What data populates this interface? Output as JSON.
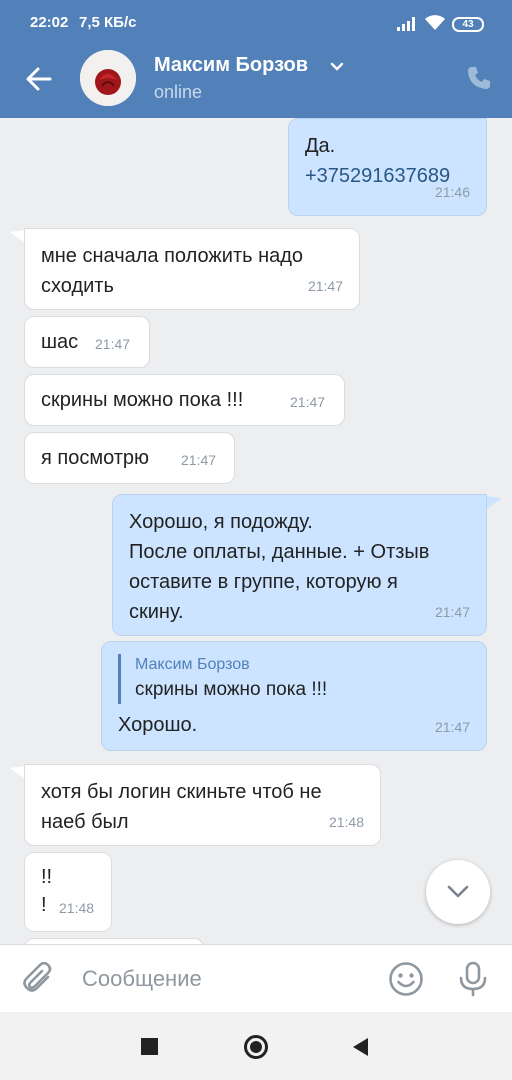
{
  "status": {
    "time": "22:02",
    "speed": "7,5 КБ/с",
    "battery": "43"
  },
  "header": {
    "contact_name": "Максим Борзов",
    "presence": "online"
  },
  "messages": [
    {
      "dir": "out",
      "lines": "Да.",
      "link": "+375291637689",
      "time": "21:46"
    },
    {
      "dir": "in",
      "lines": "мне сначала положить надо\nсходить",
      "time": "21:47"
    },
    {
      "dir": "in",
      "lines": "шас",
      "time": "21:47"
    },
    {
      "dir": "in",
      "lines": "скрины можно пока !!!",
      "time": "21:47"
    },
    {
      "dir": "in",
      "lines": "я посмотрю",
      "time": "21:47"
    },
    {
      "dir": "out",
      "lines": "Хорошо, я подожду.\nПосле оплаты, данные. + Отзыв\nоставите в группе, которую я\nскину.",
      "time": "21:47"
    },
    {
      "dir": "out",
      "reply_name": "Максим Борзов",
      "reply_text": "скрины можно пока !!!",
      "lines": "Хорошо.",
      "time": "21:47"
    },
    {
      "dir": "in",
      "lines": "хотя бы логин скиньте чтоб не\nнаеб был",
      "time": "21:48"
    },
    {
      "dir": "in",
      "lines": "!!\n!",
      "time": "21:48"
    }
  ],
  "composer": {
    "placeholder": "Сообщение"
  },
  "colors": {
    "header": "#5181b8",
    "incoming": "#ffffff",
    "outgoing": "#cce4ff",
    "link": "#2a5885"
  },
  "icons": [
    "back-arrow-icon",
    "chevron-down-icon",
    "phone-icon",
    "attach-icon",
    "emoji-icon",
    "mic-icon",
    "scroll-down-icon"
  ]
}
